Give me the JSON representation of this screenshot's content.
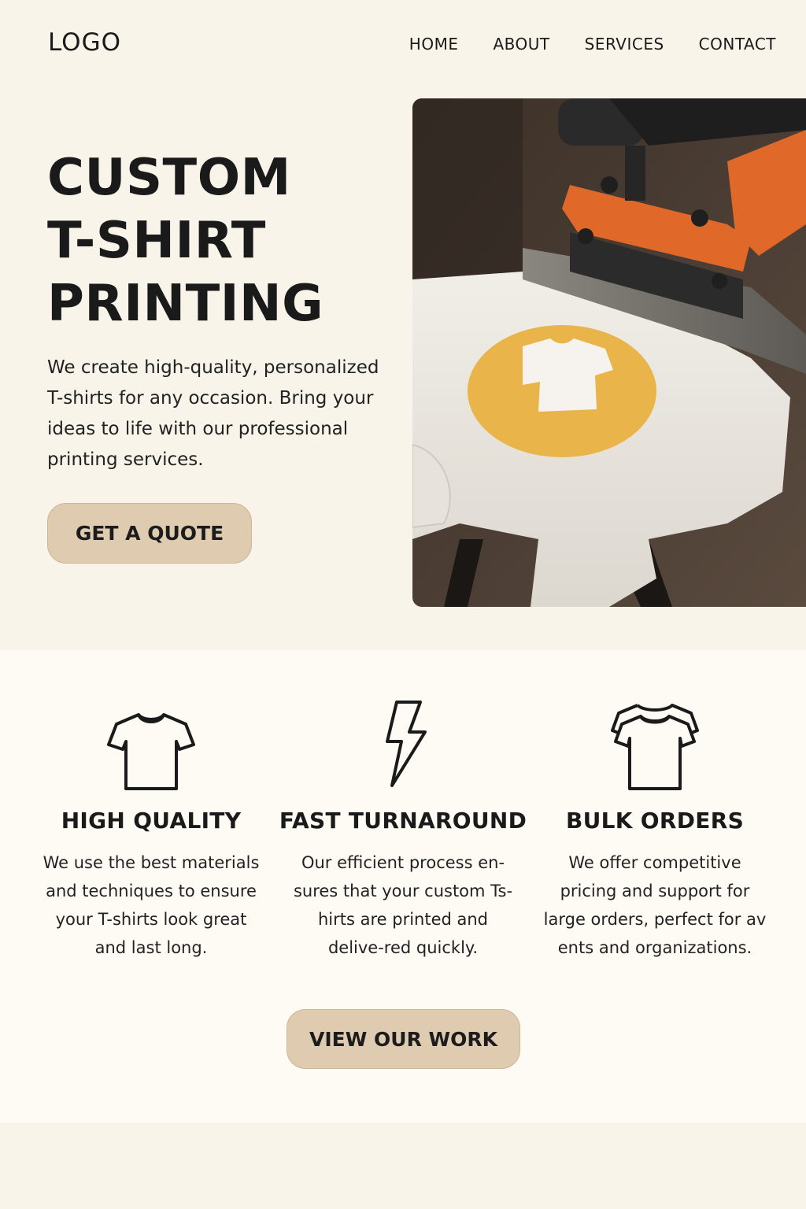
{
  "header": {
    "logo": "LOGO",
    "nav": [
      "HOME",
      "ABOUT",
      "SERVICES",
      "CONTACT"
    ]
  },
  "hero": {
    "title_lines": [
      "CUSTOM",
      "T-SHIRT",
      "PRINTING"
    ],
    "description": "We create high-quality, personalized T-shirts for any occasion. Bring your ideas to life with our professional printing services.",
    "cta": "GET A QUOTE",
    "image": "heat-press-printing-tshirt-photo"
  },
  "features": [
    {
      "icon": "tshirt-icon",
      "title": "HIGH QUALITY",
      "text": "We use the best materials and techniques to ensure your T-shirts look great and last long."
    },
    {
      "icon": "lightning-bolt-icon",
      "title": "FAST TURNAROUND",
      "text": "Our efficient process en-sures that your custom Ts-hirts are printed and delive-red quickly."
    },
    {
      "icon": "stacked-tshirts-icon",
      "title": "BULK ORDERS",
      "text": "We offer competitive pricing and support for large orders, perfect for av ents and organizations."
    }
  ],
  "work_cta": "VIEW OUR WORK",
  "colors": {
    "background": "#f8f4ea",
    "button": "#decbb0",
    "text": "#1a1a1a",
    "accent_orange": "#e0692a",
    "accent_yellow": "#e9b54a"
  }
}
